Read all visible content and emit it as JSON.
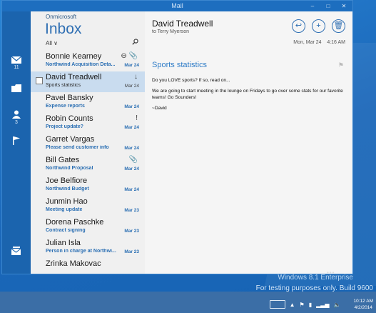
{
  "window": {
    "title": "Mail",
    "controls": [
      "–",
      "□",
      "✕"
    ]
  },
  "nav": {
    "items": [
      {
        "icon": "mail-icon",
        "count": "11"
      },
      {
        "icon": "folder-icon",
        "count": ""
      },
      {
        "icon": "people-icon",
        "count": "3"
      },
      {
        "icon": "flag-icon",
        "count": ""
      }
    ],
    "bottom_icon": "compose-mail-icon"
  },
  "list": {
    "account": "Onmicrosoft",
    "folder": "Inbox",
    "filter": "All",
    "messages": [
      {
        "from": "Bonnie Kearney",
        "subject": "Northwind Acquisition Deta...",
        "date": "Mar 24",
        "marker": "⊖ 📎"
      },
      {
        "from": "David Treadwell",
        "subject": "Sports statistics",
        "date": "Mar 24",
        "marker": "↓",
        "selected": true
      },
      {
        "from": "Pavel Bansky",
        "subject": "Expense reports",
        "date": "Mar 24",
        "marker": ""
      },
      {
        "from": "Robin Counts",
        "subject": "Project update?",
        "date": "Mar 24",
        "marker": "!"
      },
      {
        "from": "Garret Vargas",
        "subject": "Please send customer info",
        "date": "Mar 24",
        "marker": ""
      },
      {
        "from": "Bill Gates",
        "subject": "Northwind Proposal",
        "date": "Mar 24",
        "marker": "📎"
      },
      {
        "from": "Joe Belfiore",
        "subject": "Northwind Budget",
        "date": "Mar 24",
        "marker": ""
      },
      {
        "from": "Junmin Hao",
        "subject": "Meeting update",
        "date": "Mar 23",
        "marker": ""
      },
      {
        "from": "Dorena Paschke",
        "subject": "Contract signing",
        "date": "Mar 23",
        "marker": ""
      },
      {
        "from": "Julian Isla",
        "subject": "Person in charge at Northwi...",
        "date": "Mar 23",
        "marker": ""
      },
      {
        "from": "Zrinka Makovac",
        "subject": "",
        "date": "",
        "marker": ""
      }
    ]
  },
  "reading": {
    "from": "David Treadwell",
    "to": "to Terry Myerson",
    "date": "Mon, Mar 24",
    "time": "4:16 AM",
    "subject": "Sports statistics",
    "body": [
      "Do you LOVE sports?  If so, read on...",
      "We are going to start meeting in the lounge on Fridays to go over some stats for our favorite teams!  Go Sounders!",
      "~David"
    ],
    "actions": [
      "reply-icon",
      "new-icon",
      "delete-icon"
    ]
  },
  "desktop": {
    "watermark_line1": "Windows 8.1 Enterprise",
    "watermark_line2": "For testing purposes only. Build 9600",
    "clock_time": "10:12 AM",
    "clock_date": "4/2/2014"
  },
  "colors": {
    "accent": "#2f6fb3",
    "nav": "#1b64ae",
    "desktop": "#1c6fc0"
  }
}
